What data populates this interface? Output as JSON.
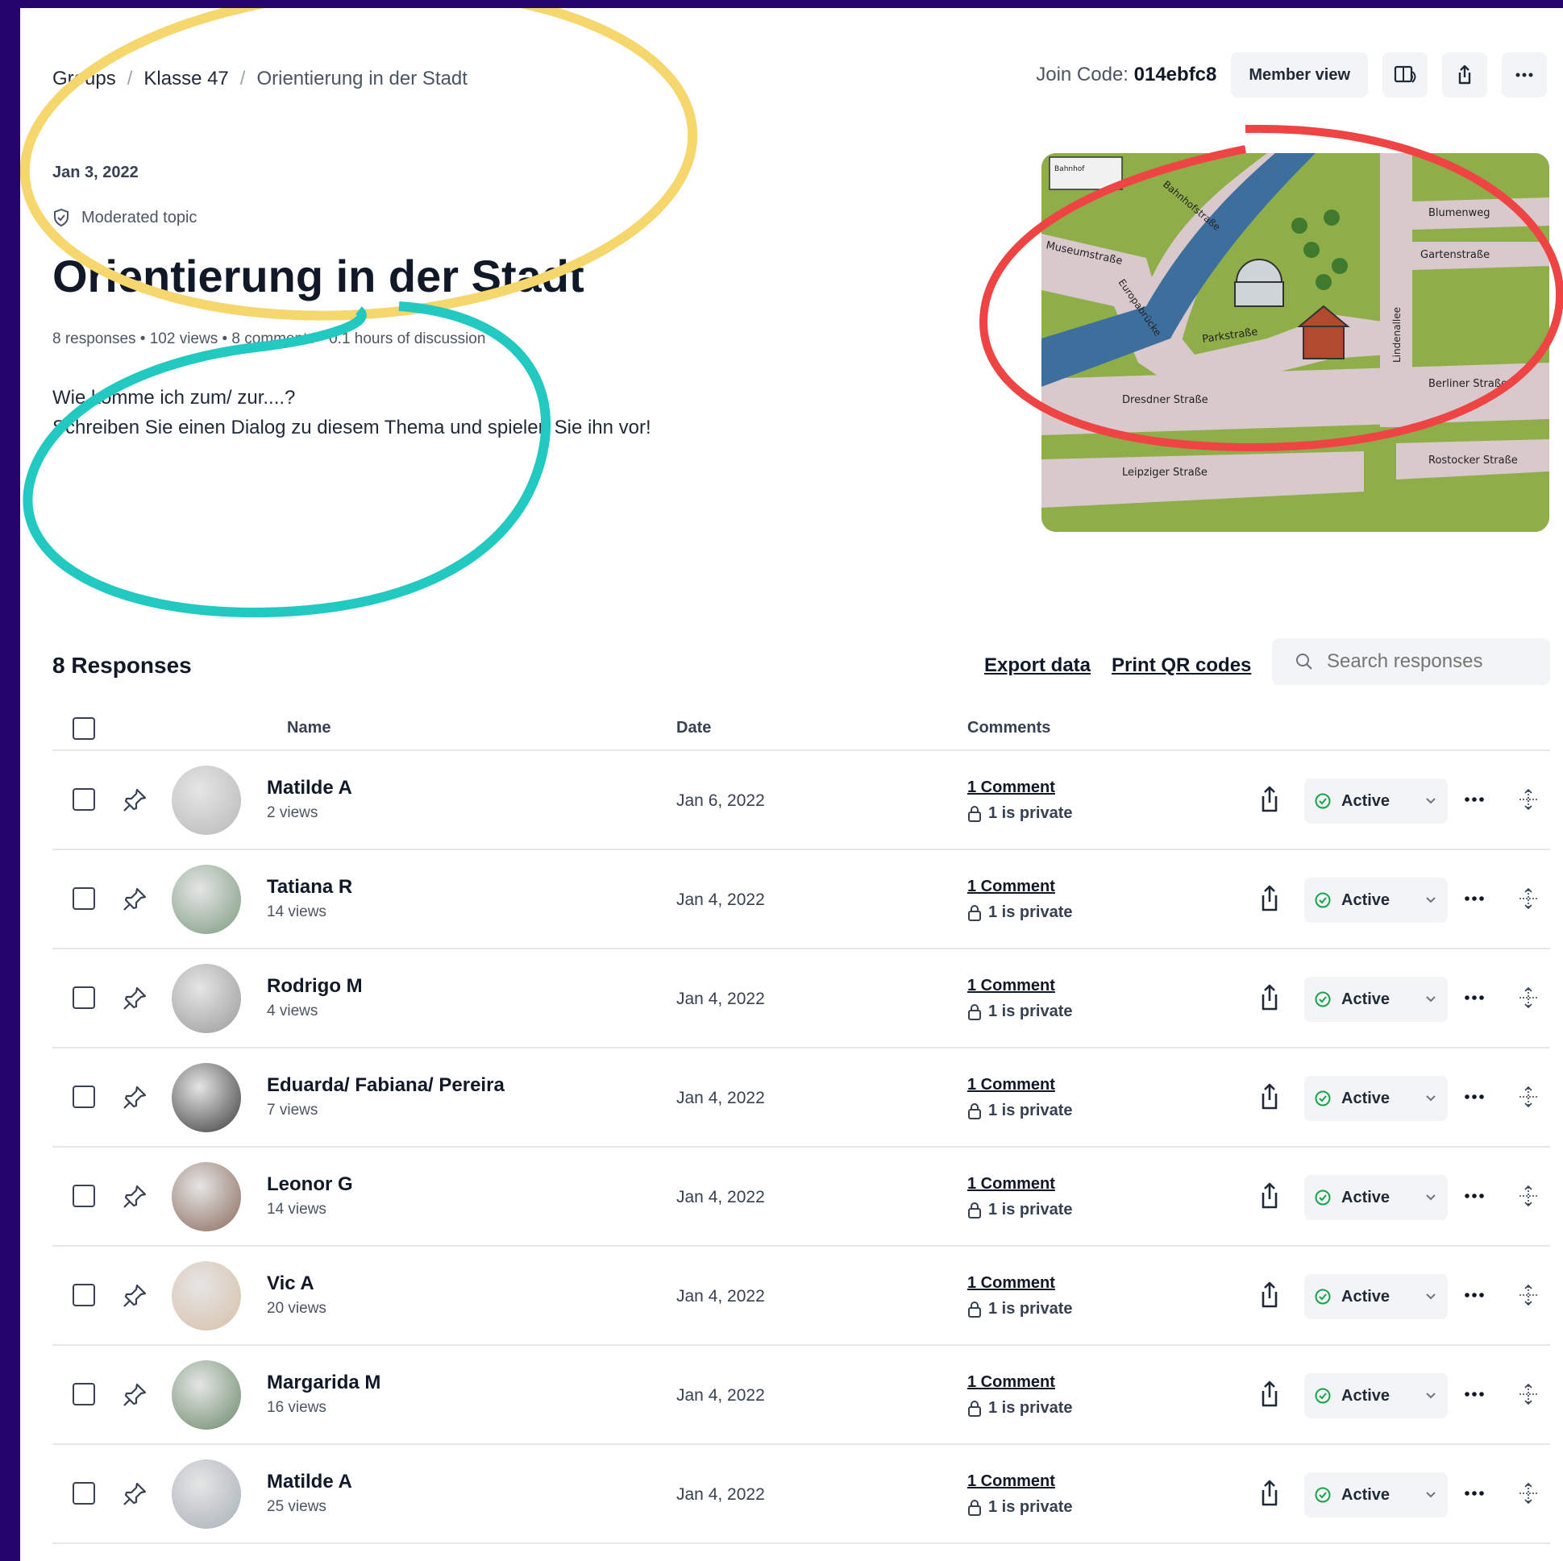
{
  "breadcrumb": {
    "groups": "Groups",
    "sep1": "/",
    "group": "Klasse 47",
    "sep2": "/",
    "topic": "Orientierung in der Stadt"
  },
  "header": {
    "join_label": "Join Code:",
    "join_code": "014ebfc8",
    "member_view": "Member view"
  },
  "topic": {
    "date": "Jan 3, 2022",
    "moderated": "Moderated topic",
    "title": "Orientierung in der Stadt",
    "stats": "8 responses • 102 views • 8 comments • 0.1 hours of discussion",
    "desc_line1": "Wie komme ich zum/ zur....?",
    "desc_line2": "Schreiben Sie einen Dialog zu diesem Thema und spielen Sie ihn vor!"
  },
  "map_labels": {
    "bahnhof": "Bahnhof",
    "bahnhofstrasse": "Bahnhofstraße",
    "blumenweg": "Blumenweg",
    "museumstrasse": "Museumstraße",
    "gartenstrasse": "Gartenstraße",
    "europabruecke": "Europabrücke",
    "parkstrasse": "Parkstraße",
    "lindenallee": "Lindenallee",
    "berliner": "Berliner Straße",
    "dresdner": "Dresdner Straße",
    "leipziger": "Leipziger Straße",
    "rostocker": "Rostocker Straße"
  },
  "responses": {
    "heading": "8 Responses",
    "export": "Export data",
    "print_qr": "Print QR codes",
    "search_placeholder": "Search responses",
    "col_name": "Name",
    "col_date": "Date",
    "col_comments": "Comments",
    "rows": [
      {
        "name": "Matilde A",
        "views": "2 views",
        "date": "Jan 6, 2022",
        "comments": "1 Comment",
        "private": "1 is private",
        "status": "Active"
      },
      {
        "name": "Tatiana R",
        "views": "14 views",
        "date": "Jan 4, 2022",
        "comments": "1 Comment",
        "private": "1 is private",
        "status": "Active"
      },
      {
        "name": "Rodrigo M",
        "views": "4 views",
        "date": "Jan 4, 2022",
        "comments": "1 Comment",
        "private": "1 is private",
        "status": "Active"
      },
      {
        "name": "Eduarda/ Fabiana/ Pereira",
        "views": "7 views",
        "date": "Jan 4, 2022",
        "comments": "1 Comment",
        "private": "1 is private",
        "status": "Active"
      },
      {
        "name": "Leonor G",
        "views": "14 views",
        "date": "Jan 4, 2022",
        "comments": "1 Comment",
        "private": "1 is private",
        "status": "Active"
      },
      {
        "name": "Vic A",
        "views": "20 views",
        "date": "Jan 4, 2022",
        "comments": "1 Comment",
        "private": "1 is private",
        "status": "Active"
      },
      {
        "name": "Margarida M",
        "views": "16 views",
        "date": "Jan 4, 2022",
        "comments": "1 Comment",
        "private": "1 is private",
        "status": "Active"
      },
      {
        "name": "Matilde A",
        "views": "25 views",
        "date": "Jan 4, 2022",
        "comments": "1 Comment",
        "private": "1 is private",
        "status": "Active"
      }
    ]
  },
  "colors": {
    "frame": "#24056b",
    "active_green": "#16a34a",
    "annotation_yellow": "#f5d76e",
    "annotation_red": "#ef4444",
    "annotation_teal": "#22c9c0"
  },
  "icons": [
    "pin-icon",
    "share-icon",
    "check-circle-icon",
    "chevron-down-icon",
    "more-icon",
    "drag-icon",
    "lock-icon",
    "search-icon",
    "shield-icon",
    "book-audio-icon"
  ]
}
